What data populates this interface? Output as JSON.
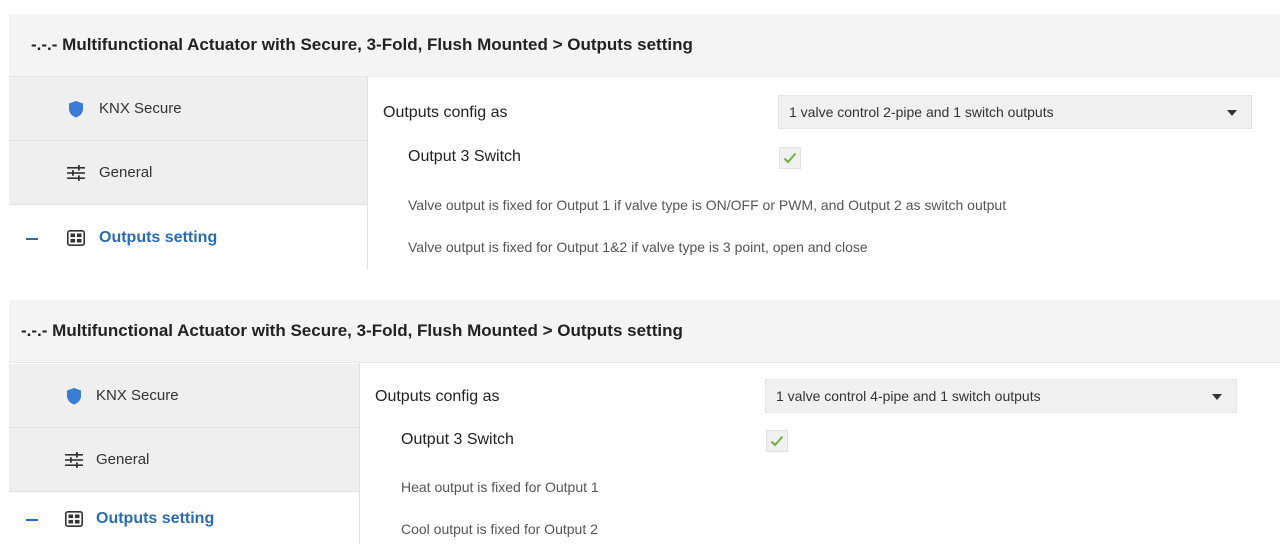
{
  "panels": [
    {
      "title": "-.-.- Multifunctional Actuator with Secure, 3-Fold, Flush Mounted > Outputs setting",
      "sidebar": {
        "items": [
          {
            "label": "KNX Secure",
            "icon": "shield-icon"
          },
          {
            "label": "General",
            "icon": "sliders-icon"
          },
          {
            "label": "Outputs setting",
            "icon": "grid-icon"
          }
        ]
      },
      "content": {
        "config_label": "Outputs config as",
        "config_value": "1 valve control 2-pipe and 1 switch outputs",
        "switch_label": "Output 3 Switch",
        "switch_checked": true,
        "notes": [
          "Valve output is fixed for Output 1 if  valve type is ON/OFF or PWM, and Output 2 as switch output",
          "Valve output is fixed for Output 1&2 if  valve type is 3 point, open and close"
        ]
      }
    },
    {
      "title": "-.-.- Multifunctional Actuator with Secure, 3-Fold, Flush Mounted > Outputs setting",
      "sidebar": {
        "items": [
          {
            "label": "KNX Secure",
            "icon": "shield-icon"
          },
          {
            "label": "General",
            "icon": "sliders-icon"
          },
          {
            "label": "Outputs setting",
            "icon": "grid-icon"
          }
        ]
      },
      "content": {
        "config_label": "Outputs config as",
        "config_value": "1 valve control 4-pipe and 1 switch outputs",
        "switch_label": "Output 3 Switch",
        "switch_checked": true,
        "notes": [
          "Heat output is fixed for Output 1",
          "Cool output is fixed for Output 2"
        ]
      }
    }
  ],
  "colors": {
    "accent": "#2b6cb0",
    "shield": "#3a7bd5",
    "check": "#6db33f",
    "sidebar_bg": "#efefef",
    "title_bg": "#f4f4f4"
  }
}
